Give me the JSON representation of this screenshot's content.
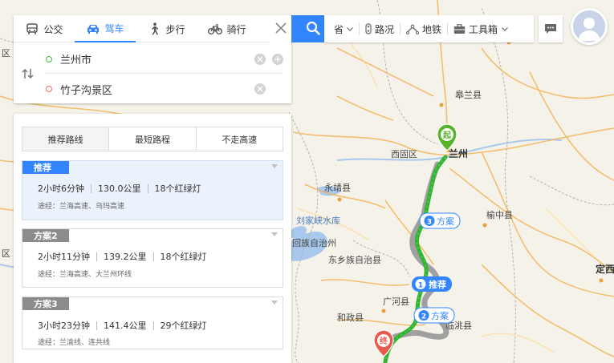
{
  "transport_modes": [
    {
      "label": "公交",
      "icon": "bus-icon",
      "active": false
    },
    {
      "label": "驾车",
      "icon": "car-icon",
      "active": true
    },
    {
      "label": "步行",
      "icon": "walk-icon",
      "active": false
    },
    {
      "label": "骑行",
      "icon": "bike-icon",
      "active": false
    }
  ],
  "route": {
    "start": "兰州市",
    "end": "竹子沟景区"
  },
  "toolbar": {
    "province_label": "省",
    "traffic_label": "路况",
    "subway_label": "地铁",
    "tools_label": "工具箱"
  },
  "preferences": [
    "推荐路线",
    "最短路程",
    "不走高速"
  ],
  "plans": [
    {
      "tag": "推荐",
      "duration": "2小时6分钟",
      "distance": "130.0公里",
      "lights": "18个红绿灯",
      "via": "途经：兰海高速、乌玛高速"
    },
    {
      "tag": "方案2",
      "duration": "2小时11分钟",
      "distance": "139.2公里",
      "lights": "18个红绿灯",
      "via": "途经：兰海高速、大兰州环线"
    },
    {
      "tag": "方案3",
      "duration": "3小时23分钟",
      "distance": "141.4公里",
      "lights": "29个红绿灯",
      "via": "途经：兰渝线、连共线"
    }
  ],
  "map": {
    "labels": {
      "gaolan": "皋兰县",
      "xigu": "西固区",
      "lanzhou": "兰州",
      "yongjing": "永靖县",
      "yuzhong": "榆中县",
      "liujiaxia": "刘家峡水库",
      "huizu": "回族自治州",
      "dongxiang": "东乡族自治县",
      "guanghe": "广河县",
      "hezheng": "和政县",
      "kangle": "临洮县",
      "dingxi": "定西",
      "edge_left_1": "区",
      "edge_left_2": "区"
    },
    "markers": {
      "start": "起",
      "end": "终"
    },
    "route_callouts": [
      {
        "num": "1",
        "text": "推荐"
      },
      {
        "num": "2",
        "text": "方案"
      },
      {
        "num": "3",
        "text": "方案"
      }
    ]
  },
  "colors": {
    "accent": "#3385ff",
    "route_main": "#2fb52f",
    "route_alt": "#a0a0a0",
    "start_marker": "#58b52a",
    "end_marker": "#e85a4f"
  }
}
